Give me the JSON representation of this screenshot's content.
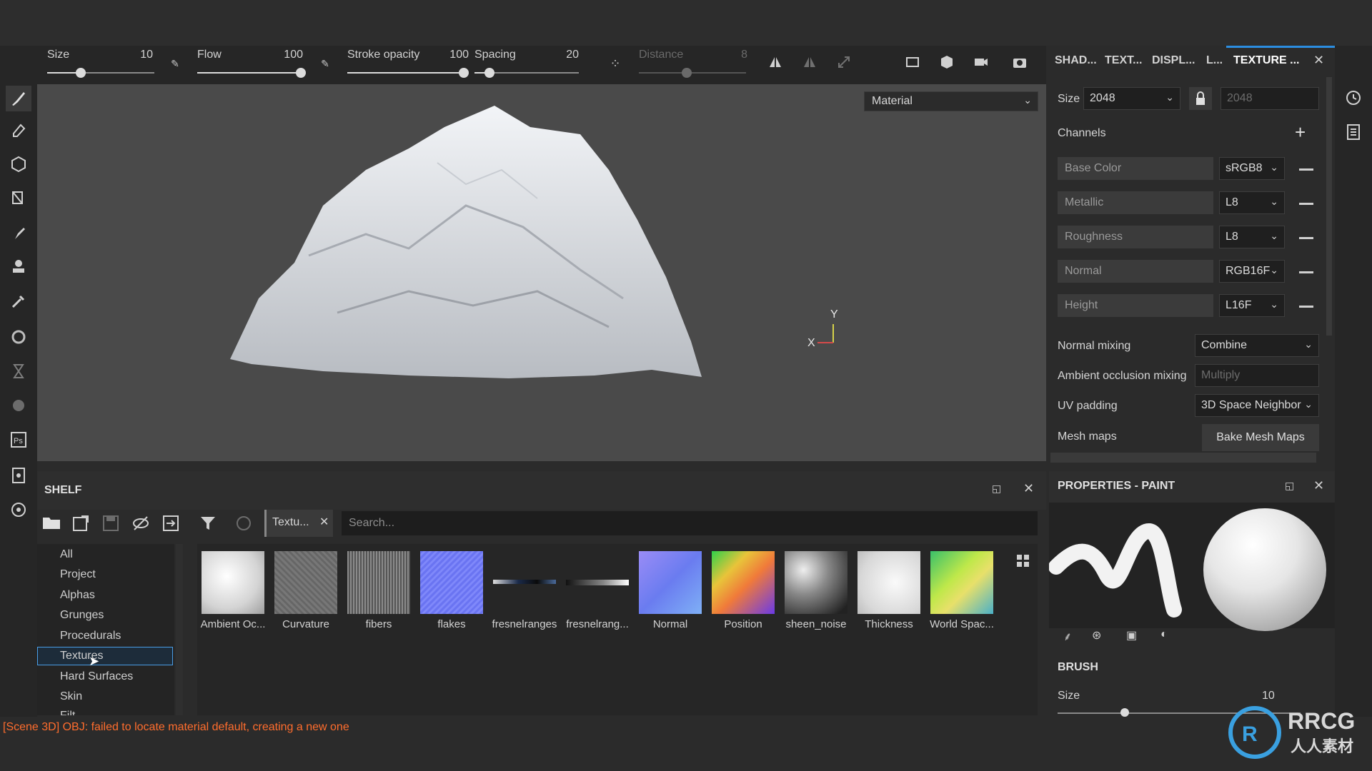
{
  "toolbar": {
    "size_label": "Size",
    "size_value": "10",
    "flow_label": "Flow",
    "flow_value": "100",
    "stroke_opacity_label": "Stroke opacity",
    "stroke_opacity_value": "100",
    "spacing_label": "Spacing",
    "spacing_value": "20",
    "distance_label": "Distance",
    "distance_value": "8"
  },
  "viewport": {
    "material_select": "Material",
    "axis_y": "Y",
    "axis_x": "X"
  },
  "right_tabs": {
    "tabs": [
      "SHAD...",
      "TEXT...",
      "DISPL...",
      "L...",
      "TEXTURE ..."
    ],
    "active": "TEXTURE ..."
  },
  "texture_settings": {
    "size_label": "Size",
    "size_value": "2048",
    "size_value_locked": "2048",
    "channels_label": "Channels",
    "channels": [
      {
        "name": "Base Color",
        "format": "sRGB8"
      },
      {
        "name": "Metallic",
        "format": "L8"
      },
      {
        "name": "Roughness",
        "format": "L8"
      },
      {
        "name": "Normal",
        "format": "RGB16F"
      },
      {
        "name": "Height",
        "format": "L16F"
      }
    ],
    "normal_mixing_label": "Normal mixing",
    "normal_mixing_value": "Combine",
    "ao_mixing_label": "Ambient occlusion mixing",
    "ao_mixing_value": "Multiply",
    "uv_padding_label": "UV padding",
    "uv_padding_value": "3D Space Neighbor",
    "mesh_maps_label": "Mesh maps",
    "bake_button": "Bake Mesh Maps"
  },
  "shelf": {
    "title": "SHELF",
    "filter_chip": "Textu...",
    "search_placeholder": "Search...",
    "categories": [
      "All",
      "Project",
      "Alphas",
      "Grunges",
      "Procedurals",
      "Textures",
      "Hard Surfaces",
      "Skin",
      "Filt..."
    ],
    "selected_category": "Textures",
    "thumbnails": [
      {
        "label": "Ambient Oc...",
        "color": "#e8e8e8"
      },
      {
        "label": "Curvature",
        "color": "#6e6e6e"
      },
      {
        "label": "fibers",
        "color": "#7a7a7a"
      },
      {
        "label": "flakes",
        "color": "#6f78f0"
      },
      {
        "label": "fresnelranges",
        "color": "#1a1a1a"
      },
      {
        "label": "fresnelrang...",
        "color": "#1a1a1a"
      },
      {
        "label": "Normal",
        "color": "#7c7cf6"
      },
      {
        "label": "Position",
        "color": "#e05a6a"
      },
      {
        "label": "sheen_noise",
        "color": "#5c5c5c"
      },
      {
        "label": "Thickness",
        "color": "#e6e6e6"
      },
      {
        "label": "World Spac...",
        "color": "#6ad06a"
      }
    ]
  },
  "properties": {
    "title": "PROPERTIES - PAINT",
    "brush_label": "BRUSH",
    "size_label": "Size",
    "size_value": "10"
  },
  "status": {
    "message": "[Scene 3D] OBJ: failed to locate material default, creating a new one"
  },
  "watermark": {
    "text": "RRCG",
    "subtext": "人人素材"
  },
  "colors": {
    "accent": "#2b8de0",
    "error": "#ff6d2d",
    "panel": "#2b2b2b",
    "viewport": "#4a4a4a"
  }
}
